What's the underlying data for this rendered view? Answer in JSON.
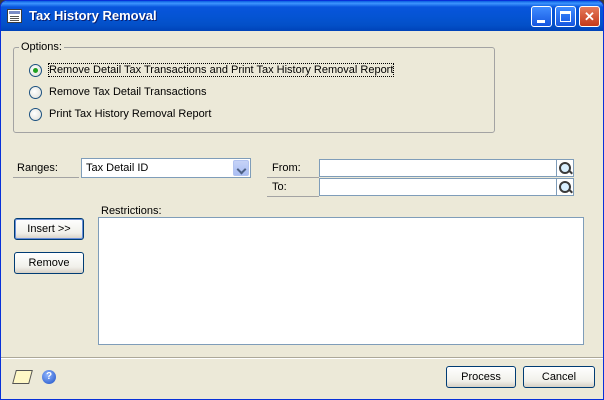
{
  "window": {
    "title": "Tax History Removal",
    "minimize_glyph": "",
    "maximize_glyph": "",
    "close_glyph": "✕"
  },
  "options": {
    "group_label": "Options:",
    "items": [
      {
        "label": "Remove Detail Tax Transactions and Print Tax History Removal Report",
        "selected": true
      },
      {
        "label": "Remove Tax Detail Transactions",
        "selected": false
      },
      {
        "label": "Print Tax History Removal Report",
        "selected": false
      }
    ]
  },
  "ranges": {
    "label": "Ranges:",
    "selected": "Tax Detail ID",
    "from_label": "From:",
    "to_label": "To:",
    "from_value": "",
    "to_value": ""
  },
  "restrictions": {
    "label": "Restrictions:"
  },
  "buttons": {
    "insert": "Insert >>",
    "remove": "Remove",
    "process": "Process",
    "cancel": "Cancel"
  },
  "footer": {
    "help_glyph": "?"
  },
  "icons": {
    "window": "tax-window-icon",
    "note": "note-icon",
    "help": "help-icon",
    "lookup": "lookup-icon"
  }
}
